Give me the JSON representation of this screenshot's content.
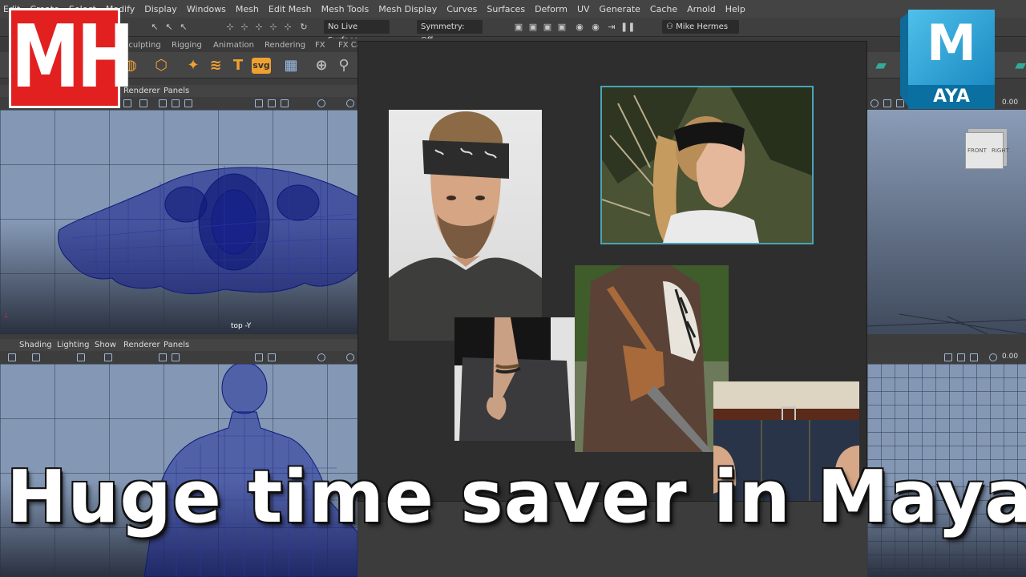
{
  "menu": [
    "Edit",
    "Create",
    "Select",
    "Modify",
    "Display",
    "Windows",
    "Mesh",
    "Edit Mesh",
    "Mesh Tools",
    "Mesh Display",
    "Curves",
    "Surfaces",
    "Deform",
    "UV",
    "Generate",
    "Cache",
    "Arnold",
    "Help"
  ],
  "status": {
    "live_surface": "No Live Surface",
    "symmetry": "Symmetry: Off",
    "user": "Mike Hermes"
  },
  "shelf_tabs": [
    "Sculpting",
    "Rigging",
    "Animation",
    "Rendering",
    "FX",
    "FX Ca"
  ],
  "shelf_text_tool": "T",
  "shelf_svg_tool": "svg",
  "top_left_panel": {
    "menu": [
      "Renderer",
      "Panels"
    ],
    "label": "top -Y"
  },
  "top_right_panel": {
    "value": "0.00",
    "viewcube_front": "FRONT",
    "viewcube_right": "RIGHT"
  },
  "bottom_left_panel": {
    "menu": [
      "Shading",
      "Lighting",
      "Show",
      "Renderer",
      "Panels"
    ]
  },
  "bottom_right_panel": {
    "value": "0.00"
  },
  "logo_mh": "MH",
  "logo_maya": {
    "letter": "M",
    "word": "AYA",
    "accent": "#1a8ac2"
  },
  "headline": "Huge time saver in Maya",
  "colors": {
    "logo_red": "#e22020",
    "wire": "#0e1a7a",
    "viewport": "#8498b5"
  }
}
